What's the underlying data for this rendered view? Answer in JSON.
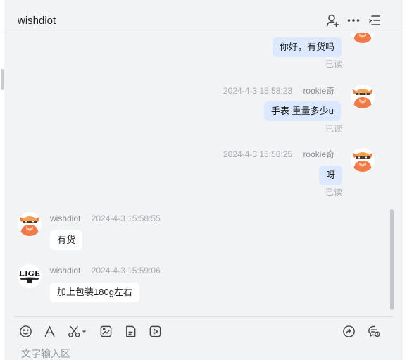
{
  "header": {
    "title": "wishdiot"
  },
  "messages": [
    {
      "time": "",
      "name": "",
      "text": "你好，有货吗",
      "read": "已读"
    },
    {
      "time": "2024-4-3 15:58:23",
      "name": "rookie奇",
      "text": "手表 重量多少u",
      "read": "已读"
    },
    {
      "time": "2024-4-3 15:58:25",
      "name": "rookie奇",
      "text": "呀",
      "read": "已读"
    },
    {
      "time": "2024-4-3 15:58:55",
      "name": "wishdiot",
      "text": "有货"
    },
    {
      "time": "2024-4-3 15:59:06",
      "name": "wishdiot",
      "text": "加上包装180g左右",
      "avatar_text": "LIGE"
    }
  ],
  "composer": {
    "placeholder": "文字输入区"
  },
  "colors": {
    "outgoing_bubble": "#dbe8fe",
    "incoming_bubble": "#ffffff",
    "panel_bg": "#f2f3f5",
    "avatar_orange": "#f07a4a"
  }
}
